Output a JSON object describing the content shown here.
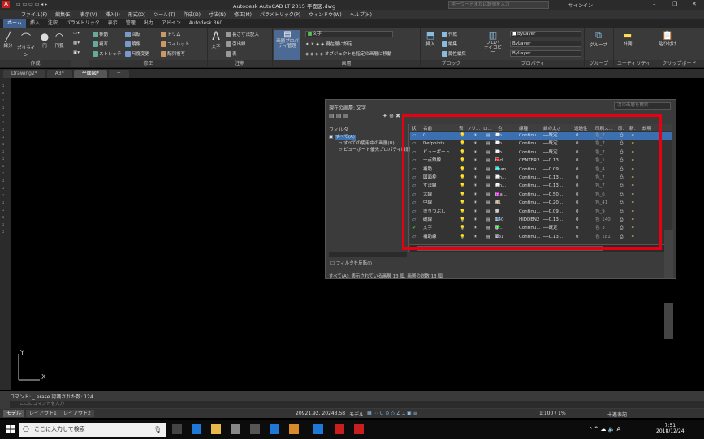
{
  "window": {
    "title": "Autodesk AutoCAD LT 2015   平面図.dwg",
    "search_placeholder": "キーワードまたは語句を入力",
    "signin": "サインイン"
  },
  "menubar": [
    "ファイル(F)",
    "編集(E)",
    "表示(V)",
    "挿入(I)",
    "形式(O)",
    "ツール(T)",
    "作成(D)",
    "寸法(N)",
    "修正(M)",
    "パラメトリック(P)",
    "ウィンドウ(W)",
    "ヘルプ(H)"
  ],
  "ribbon_tabs": [
    "ホーム",
    "挿入",
    "注釈",
    "パラメトリック",
    "表示",
    "管理",
    "出力",
    "アドイン",
    "Autodesk 360"
  ],
  "ribbon": {
    "draw": {
      "label": "作成",
      "line": "線分",
      "polyline": "ポリライン",
      "circle": "円",
      "arc": "円弧"
    },
    "modify": {
      "label": "修正",
      "move": "移動",
      "rotate": "回転",
      "trim": "トリム",
      "copy": "複写",
      "mirror": "鏡像",
      "fillet": "フィレット",
      "stretch": "ストレッチ",
      "scale": "尺度変更",
      "array": "配列複写"
    },
    "annotation": {
      "label": "注釈",
      "text": "文字",
      "dim": "長さ寸法記入",
      "leader": "引出線",
      "table": "表"
    },
    "layers": {
      "label": "画層",
      "props": "画層プロパティ管理",
      "current": "現在層に設定",
      "match": "オブジェクトを指定の画層に移動",
      "combo": "文字"
    },
    "block": {
      "label": "ブロック",
      "insert": "挿入",
      "create": "作成",
      "edit": "編集",
      "attr": "属性編集"
    },
    "properties": {
      "label": "プロパティ",
      "match": "プロパティコピー",
      "bylayer1": "ByLayer",
      "bylayer2": "ByLayer",
      "bylayer3": "ByLayer"
    },
    "groups": {
      "label": "グループ",
      "group": "グループ"
    },
    "utilities": {
      "label": "ユーティリティ",
      "measure": "計測"
    },
    "clipboard": {
      "label": "クリップボード",
      "paste": "貼り付け"
    }
  },
  "doc_tabs": [
    "Drawing2*",
    "A3*",
    "平面図*"
  ],
  "layer_panel": {
    "current_layer": "現在の画層: 文字",
    "search_placeholder": "次の画層を検索",
    "filter_title": "フィルタ",
    "tree": [
      "すべて(A)",
      "すべての使用中の画層(U)",
      "ビューポート優先プロパティ画層"
    ],
    "invert_filter": "フィルタを反転(I)",
    "status": "すべて(A): 表示されている画層 13 個, 画層の総数 13 個",
    "headers": [
      "状.",
      "名前",
      "表.",
      "フリ...",
      "ロ...",
      "色",
      "線種",
      "線の太さ",
      "透過性",
      "印刷ス...",
      "印.",
      "新.",
      "説明"
    ],
    "rows": [
      {
        "name": "0",
        "color": "wh...",
        "swatch": "#ffffff",
        "ltype": "Continu...",
        "lw": "既定",
        "tr": "0",
        "plot": "色_7",
        "sel": true
      },
      {
        "name": "Defpoints",
        "color": "wh...",
        "swatch": "#ffffff",
        "ltype": "Continu...",
        "lw": "既定",
        "tr": "0",
        "plot": "色_7"
      },
      {
        "name": "ビューポート",
        "color": "wh...",
        "swatch": "#ffffff",
        "ltype": "Continu...",
        "lw": "既定",
        "tr": "0",
        "plot": "色_7"
      },
      {
        "name": "一点鎖線",
        "color": "red",
        "swatch": "#ff0000",
        "ltype": "CENTER2",
        "lw": "0.13...",
        "tr": "0",
        "plot": "色_1"
      },
      {
        "name": "補助",
        "color": "cyan",
        "swatch": "#00ffff",
        "ltype": "Continu...",
        "lw": "0.09...",
        "tr": "0",
        "plot": "色_4"
      },
      {
        "name": "図面枠",
        "color": "wh...",
        "swatch": "#ffffff",
        "ltype": "Continu...",
        "lw": "0.13...",
        "tr": "0",
        "plot": "色_7"
      },
      {
        "name": "寸法線",
        "color": "wh...",
        "swatch": "#ffffff",
        "ltype": "Continu...",
        "lw": "0.13...",
        "tr": "0",
        "plot": "色_7"
      },
      {
        "name": "太線",
        "color": "ma...",
        "swatch": "#ff00ff",
        "ltype": "Continu...",
        "lw": "0.50...",
        "tr": "0",
        "plot": "色_6"
      },
      {
        "name": "中線",
        "color": "41",
        "swatch": "#c8a060",
        "ltype": "Continu...",
        "lw": "0.20...",
        "tr": "0",
        "plot": "色_41"
      },
      {
        "name": "塗りつぶし",
        "color": "9",
        "swatch": "#c0c0c0",
        "ltype": "Continu...",
        "lw": "0.09...",
        "tr": "0",
        "plot": "色_9"
      },
      {
        "name": "破線",
        "color": "140",
        "swatch": "#4080c0",
        "ltype": "HIDDEN2",
        "lw": "0.13...",
        "tr": "0",
        "plot": "色_140"
      },
      {
        "name": "文字",
        "color": "gr...",
        "swatch": "#00ff00",
        "ltype": "Continu...",
        "lw": "既定",
        "tr": "0",
        "plot": "色_3"
      },
      {
        "name": "補助線",
        "color": "181",
        "swatch": "#7f7fbf",
        "ltype": "Continu...",
        "lw": "0.13...",
        "tr": "0",
        "plot": "色_181"
      }
    ]
  },
  "command": {
    "last": "コマンド: _.erase 認識された数: 124",
    "prompt": "ここにコマンドを入力"
  },
  "layout_tabs": [
    "モデル",
    "レイアウト1",
    "レイアウト2"
  ],
  "statusbar": {
    "coords": "20921.92, 20243.58",
    "model": "モデル",
    "scale": "1:100 / 1%",
    "anno": "十進表記"
  },
  "taskbar": {
    "search": "ここに入力して検索",
    "time": "7:51",
    "date": "2018/12/24"
  }
}
